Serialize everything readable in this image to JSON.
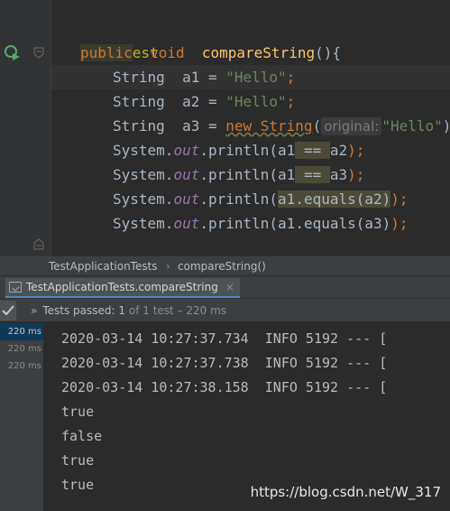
{
  "editor": {
    "annotation": "@Test",
    "method_modifier": "public",
    "method_return": "void",
    "method_name": "compareString",
    "method_suffix": "(){",
    "lines": [
      {
        "type": "String",
        "var": "a1",
        "eq": " = ",
        "value": "\"Hello\"",
        "end": ";"
      },
      {
        "type": "String",
        "var": "a2",
        "eq": " = ",
        "value": "\"Hello\"",
        "end": ";"
      },
      {
        "type": "String",
        "var": "a3",
        "eq": " = ",
        "new_kw": "new String",
        "paren": "(",
        "hint": "original:",
        "value": "\"Hello\"",
        "end": ");"
      }
    ],
    "print_lines": [
      {
        "obj": "System.",
        "field": "out",
        "call": ".println(",
        "arg_a": "a1",
        "op": " == ",
        "arg_b": "a2",
        "end": ");"
      },
      {
        "obj": "System.",
        "field": "out",
        "call": ".println(",
        "arg_a": "a1",
        "op": " == ",
        "arg_b": "a3",
        "end": ");"
      },
      {
        "obj": "System.",
        "field": "out",
        "call": ".println(",
        "expr": "a1.equals(a2)",
        "end": ");"
      },
      {
        "obj": "System.",
        "field": "out",
        "call": ".println(",
        "expr": "a1.equals(a3)",
        "end": ");"
      }
    ],
    "closing_brace": "}"
  },
  "breadcrumb": {
    "class_name": "TestApplicationTests",
    "separator": "›",
    "method_name": "compareString()"
  },
  "run_panel": {
    "tab_label": "TestApplicationTests.compareString",
    "tab_close": "×",
    "status_chevron": "»",
    "status_prefix": "Tests passed:",
    "status_count": "1",
    "status_suffix": "of 1 test – 220 ms",
    "tree_times": [
      "220 ms",
      "220 ms",
      "220 ms"
    ],
    "console_lines": [
      "2020-03-14 10:27:37.734  INFO 5192 --- [",
      "2020-03-14 10:27:37.738  INFO 5192 --- [",
      "2020-03-14 10:27:38.158  INFO 5192 --- [",
      "true",
      "false",
      "true",
      "true"
    ]
  },
  "watermark": "https://blog.csdn.net/W_317",
  "colors": {
    "background": "#2b2b2b",
    "keyword": "#cc7832",
    "string": "#6a8759",
    "method": "#ffc66d",
    "annotation": "#bbb529",
    "field": "#9876aa",
    "selection_accent": "#4a88c7",
    "pass_green": "#5f9e57"
  },
  "icons": {
    "run": "run-test-icon",
    "fold": "fold-marker-icon",
    "check": "check-icon",
    "tab": "test-config-icon"
  }
}
